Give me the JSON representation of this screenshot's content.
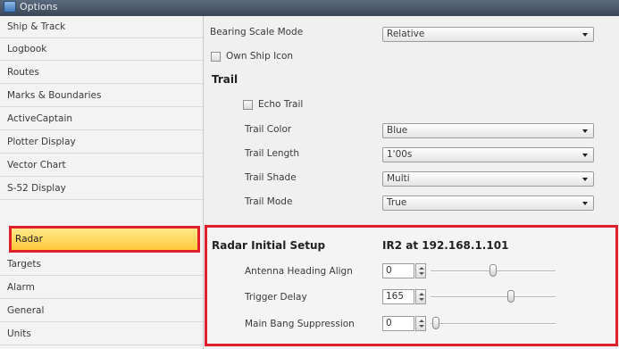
{
  "window": {
    "title": "Options"
  },
  "sidebar": {
    "items": [
      {
        "label": "Ship & Track",
        "name": "ship-track"
      },
      {
        "label": "Logbook",
        "name": "logbook"
      },
      {
        "label": "Routes",
        "name": "routes"
      },
      {
        "label": "Marks & Boundaries",
        "name": "marks-boundaries"
      },
      {
        "label": "ActiveCaptain",
        "name": "activecaptain"
      },
      {
        "label": "Plotter Display",
        "name": "plotter-display"
      },
      {
        "label": "Vector Chart",
        "name": "vector-chart"
      },
      {
        "label": "S-52 Display",
        "name": "s52-display"
      },
      {
        "label": "Radar",
        "name": "radar"
      },
      {
        "label": "Targets",
        "name": "targets"
      },
      {
        "label": "Alarm",
        "name": "alarm"
      },
      {
        "label": "General",
        "name": "general"
      },
      {
        "label": "Units",
        "name": "units"
      }
    ],
    "selected": "Radar"
  },
  "settings": {
    "bearing_scale_mode": {
      "label": "Bearing Scale Mode",
      "value": "Relative"
    },
    "own_ship_icon": {
      "label": "Own Ship Icon",
      "checked": false
    },
    "trail": {
      "title": "Trail",
      "echo_trail": {
        "label": "Echo Trail",
        "checked": false
      },
      "trail_color": {
        "label": "Trail Color",
        "value": "Blue"
      },
      "trail_length": {
        "label": "Trail Length",
        "value": "1'00s"
      },
      "trail_shade": {
        "label": "Trail Shade",
        "value": "Multi"
      },
      "trail_mode": {
        "label": "Trail Mode",
        "value": "True"
      }
    }
  },
  "radar_setup": {
    "title": "Radar Initial Setup",
    "device": "IR2 at 192.168.1.101",
    "antenna_heading_align": {
      "label": "Antenna Heading Align",
      "value": "0",
      "level": 0.5
    },
    "trigger_delay": {
      "label": "Trigger Delay",
      "value": "165",
      "level": 0.66
    },
    "main_bang_suppression": {
      "label": "Main Bang Suppression",
      "value": "0",
      "level": 0.0
    }
  },
  "colors": {
    "highlight": "#e0202a",
    "selected_bg": "#ffd24a"
  }
}
